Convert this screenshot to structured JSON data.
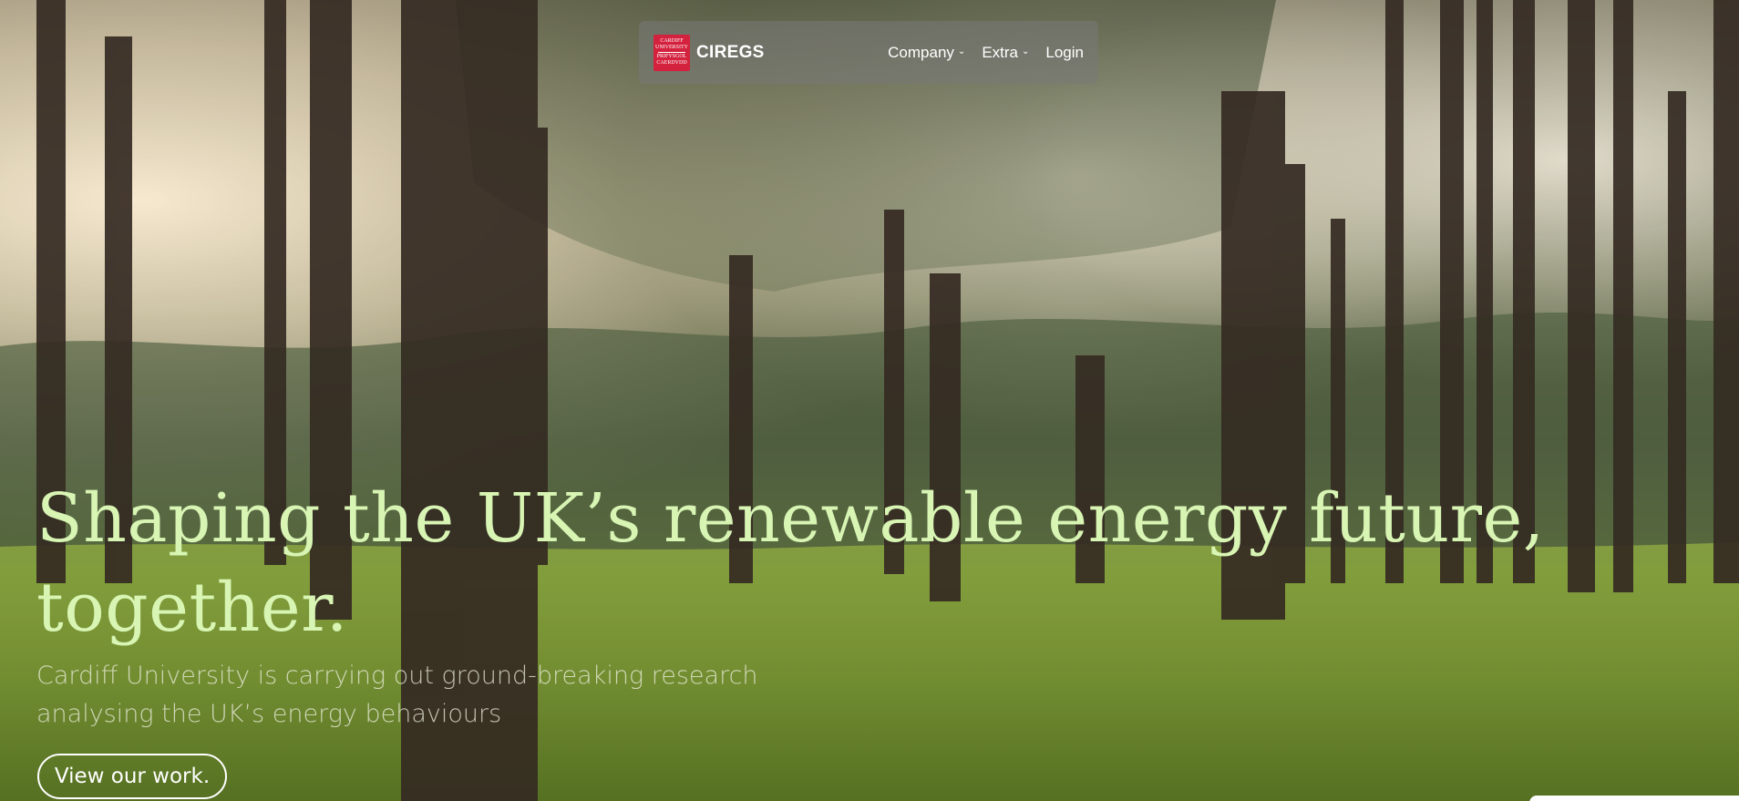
{
  "header": {
    "logo_text": "CARDIFF UNIVERSITY PRIFYSGOL CAERDYDD",
    "brand": "CIREGS",
    "nav": [
      {
        "label": "Company",
        "icon": "chevron-down-icon"
      },
      {
        "label": "Extra",
        "icon": "chevron-down-icon"
      },
      {
        "label": "Login"
      }
    ],
    "chevron_glyph": "⌄"
  },
  "hero": {
    "headline": "Shaping the UK’s renewable energy future, together.",
    "subtext_line1": "Cardiff University is carrying out ground-breaking research",
    "subtext_line2": "analysing the UK’s energy behaviours",
    "cta_label": "View our work."
  },
  "colors": {
    "headline": "#d8f5b4",
    "navbar_bg": "rgba(120,120,120,0.55)",
    "logo_bg": "#d4213d",
    "text_light": "#ffffff"
  }
}
